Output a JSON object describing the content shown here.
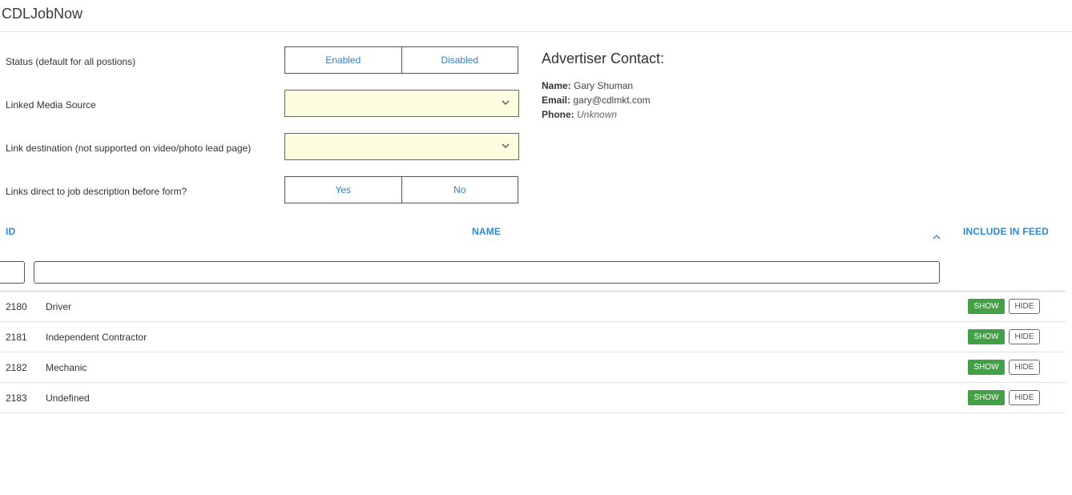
{
  "app": {
    "title": "CDLJobNow"
  },
  "form": {
    "status": {
      "label": "Status (default for all postions)",
      "options": [
        "Enabled",
        "Disabled"
      ]
    },
    "media_source": {
      "label": "Linked Media Source",
      "value": ""
    },
    "link_destination": {
      "label": "Link destination (not supported on video/photo lead page)",
      "value": ""
    },
    "direct_links": {
      "label": "Links direct to job description before form?",
      "options": [
        "Yes",
        "No"
      ]
    }
  },
  "contact": {
    "title": "Advertiser Contact:",
    "name_label": "Name:",
    "name": "Gary Shuman",
    "email_label": "Email:",
    "email": "gary@cdlmkt.com",
    "phone_label": "Phone:",
    "phone": "Unknown"
  },
  "table": {
    "headers": {
      "id": "ID",
      "name": "NAME",
      "feed": "INCLUDE IN FEED"
    },
    "filters": {
      "id": "",
      "name": ""
    },
    "rows": [
      {
        "id": "2180",
        "name": "Driver",
        "show": "SHOW",
        "hide": "HIDE"
      },
      {
        "id": "2181",
        "name": "Independent Contractor",
        "show": "SHOW",
        "hide": "HIDE"
      },
      {
        "id": "2182",
        "name": "Mechanic",
        "show": "SHOW",
        "hide": "HIDE"
      },
      {
        "id": "2183",
        "name": "Undefined",
        "show": "SHOW",
        "hide": "HIDE"
      }
    ]
  },
  "colors": {
    "link_blue": "#2f7fcf",
    "header_blue": "#2f8ad6",
    "show_green": "#43a047",
    "hide_red": "#e53935",
    "select_bg": "#fdfde0"
  },
  "icons": {
    "select_caret": "chevron-down-icon",
    "sort": "chevron-up-icon"
  }
}
